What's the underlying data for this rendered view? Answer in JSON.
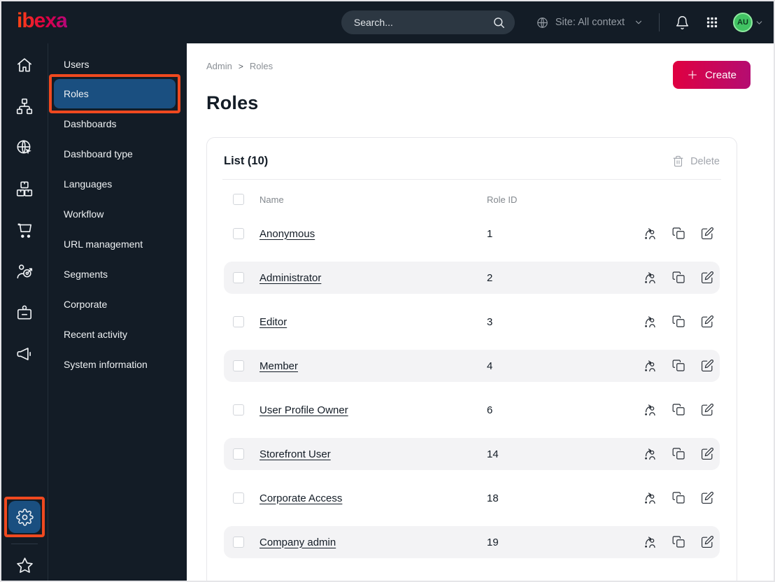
{
  "topbar": {
    "logo": "ibexa",
    "search_placeholder": "Search...",
    "site_context_label": "Site: All context",
    "avatar_initials": "AU"
  },
  "icon_rail": {
    "items": [
      "home-icon",
      "content-structure-icon",
      "site-globe-icon",
      "products-boxes-icon",
      "commerce-cart-icon",
      "personalization-target-icon",
      "corporate-badge-icon",
      "marketing-megaphone-icon",
      "settings-gear-icon",
      "favorites-star-icon"
    ],
    "active_item": "settings-gear-icon"
  },
  "sidebar": {
    "items": [
      {
        "label": "Users",
        "selected": false
      },
      {
        "label": "Roles",
        "selected": true
      },
      {
        "label": "Dashboards",
        "selected": false
      },
      {
        "label": "Dashboard type",
        "selected": false
      },
      {
        "label": "Languages",
        "selected": false
      },
      {
        "label": "Workflow",
        "selected": false
      },
      {
        "label": "URL management",
        "selected": false
      },
      {
        "label": "Segments",
        "selected": false
      },
      {
        "label": "Corporate",
        "selected": false
      },
      {
        "label": "Recent activity",
        "selected": false
      },
      {
        "label": "System information",
        "selected": false
      }
    ]
  },
  "main": {
    "breadcrumb": {
      "items": [
        "Admin",
        "Roles"
      ]
    },
    "create_label": "Create",
    "page_title": "Roles",
    "list": {
      "title": "List (10)",
      "delete_label": "Delete",
      "columns": {
        "name": "Name",
        "role_id": "Role ID"
      },
      "rows": [
        {
          "name": "Anonymous",
          "role_id": "1"
        },
        {
          "name": "Administrator",
          "role_id": "2"
        },
        {
          "name": "Editor",
          "role_id": "3"
        },
        {
          "name": "Member",
          "role_id": "4"
        },
        {
          "name": "User Profile Owner",
          "role_id": "6"
        },
        {
          "name": "Storefront User",
          "role_id": "14"
        },
        {
          "name": "Corporate Access",
          "role_id": "18"
        },
        {
          "name": "Company admin",
          "role_id": "19"
        }
      ]
    }
  },
  "colors": {
    "topbar_bg": "#131c26",
    "selected_blue": "#1a4f80",
    "annotation_orange": "#f0491f",
    "create_gradient_start": "#e00040",
    "create_gradient_end": "#b40d72",
    "avatar_green": "#41c363",
    "row_alt_bg": "#f3f3f5",
    "muted_text": "#8a8f95"
  }
}
